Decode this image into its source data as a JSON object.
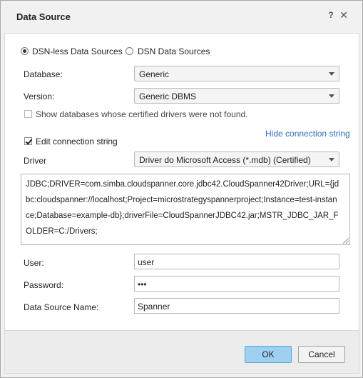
{
  "dialog": {
    "title": "Data Source",
    "help_icon": "?",
    "close_icon": "✕"
  },
  "mode": {
    "dsn_less_label": "DSN-less Data Sources",
    "dsn_label": "DSN Data Sources",
    "selected": "dsn_less"
  },
  "database": {
    "label": "Database:",
    "value": "Generic"
  },
  "version": {
    "label": "Version:",
    "value": "Generic DBMS"
  },
  "show_uncertified": {
    "label": "Show databases whose certified drivers were not found.",
    "checked": false
  },
  "edit_connection": {
    "label": "Edit connection string",
    "checked": true
  },
  "hide_link": "Hide connection string",
  "driver": {
    "label": "Driver",
    "value": "Driver do Microsoft Access (*.mdb) (Certified)"
  },
  "connection_string": "JDBC;DRIVER=com.simba.cloudspanner.core.jdbc42.CloudSpanner42Driver;URL={jdbc:cloudspanner://localhost;Project=microstrategyspannerproject;Instance=test-instance;Database=example-db};driverFile=CloudSpannerJDBC42.jar;MSTR_JDBC_JAR_FOLDER=C:/Drivers;",
  "user": {
    "label": "User:",
    "value": "user"
  },
  "password": {
    "label": "Password:",
    "value": "•••"
  },
  "data_source_name": {
    "label": "Data Source Name:",
    "value": "Spanner"
  },
  "buttons": {
    "ok": "OK",
    "cancel": "Cancel"
  },
  "colors": {
    "ok_button": "#9fd0f1",
    "link": "#2f6fb6"
  }
}
